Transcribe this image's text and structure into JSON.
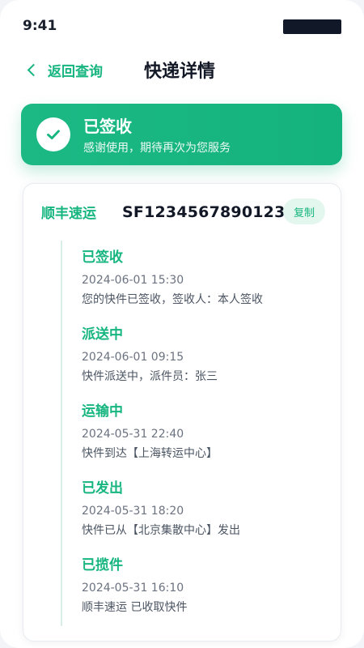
{
  "statusbar": {
    "time": "9:41"
  },
  "header": {
    "back_label": "返回查询",
    "title": "快递详情"
  },
  "banner": {
    "title": "已签收",
    "subtitle": "感谢使用，期待再次为您服务"
  },
  "card": {
    "carrier": "顺丰速运",
    "tracking_number": "SF1234567890123",
    "copy_label": "复制",
    "events": [
      {
        "status": "已签收",
        "time": "2024-06-01 15:30",
        "desc": "您的快件已签收，签收人：本人签收"
      },
      {
        "status": "派送中",
        "time": "2024-06-01 09:15",
        "desc": "快件派送中，派件员：张三"
      },
      {
        "status": "运输中",
        "time": "2024-05-31 22:40",
        "desc": "快件到达【上海转运中心】"
      },
      {
        "status": "已发出",
        "time": "2024-05-31 18:20",
        "desc": "快件已从【北京集散中心】发出"
      },
      {
        "status": "已揽件",
        "time": "2024-05-31 16:10",
        "desc": "顺丰速运 已收取快件"
      }
    ]
  },
  "colors": {
    "accent": "#17b57f",
    "title": "#121826",
    "muted": "#6b7280"
  },
  "icons": {
    "back": "chevron-left-icon",
    "signed": "checkmark-icon"
  }
}
